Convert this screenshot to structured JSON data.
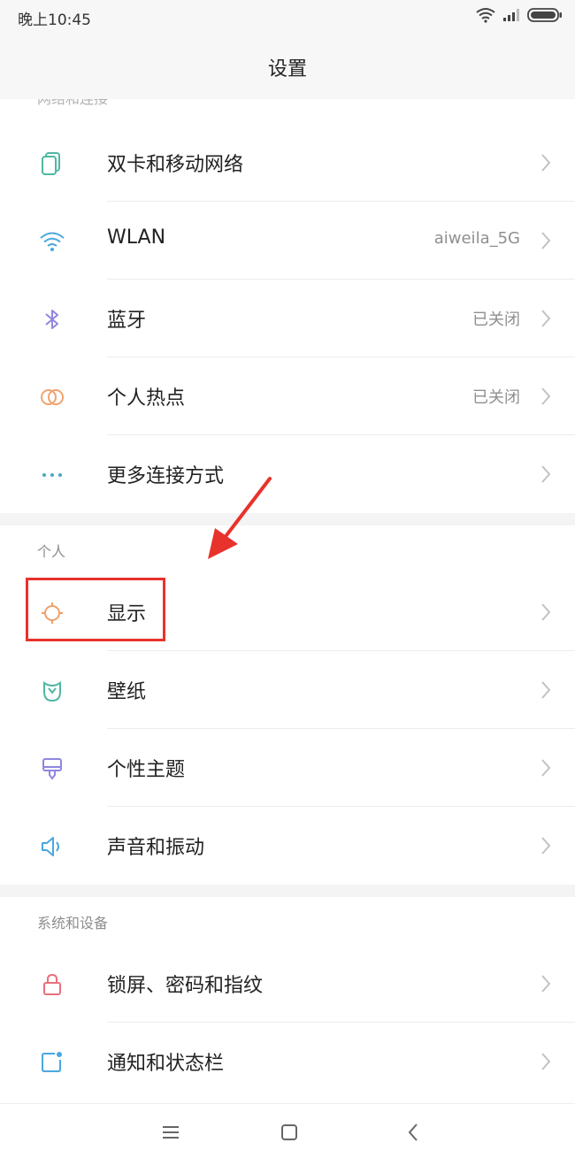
{
  "status_bar": {
    "time": "晚上10:45",
    "icons": [
      "wifi-icon",
      "signal-icon",
      "battery-icon"
    ]
  },
  "header": {
    "title": "设置"
  },
  "sections": {
    "network": {
      "header_partial": "网络和连接",
      "items": [
        {
          "label": "双卡和移动网络",
          "value": "",
          "icon": "sim-cards-icon",
          "icon_color": "#4fb7a3"
        },
        {
          "label": "WLAN",
          "value": "aiweila_5G",
          "icon": "wifi-icon",
          "icon_color": "#4aa7e0"
        },
        {
          "label": "蓝牙",
          "value": "已关闭",
          "icon": "bluetooth-icon",
          "icon_color": "#8f86e0"
        },
        {
          "label": "个人热点",
          "value": "已关闭",
          "icon": "hotspot-icon",
          "icon_color": "#f0a370"
        },
        {
          "label": "更多连接方式",
          "value": "",
          "icon": "more-dots-icon",
          "icon_color": "#4aa7c7"
        }
      ]
    },
    "personal": {
      "header": "个人",
      "items": [
        {
          "label": "显示",
          "value": "",
          "icon": "brightness-icon",
          "icon_color": "#f0a06a"
        },
        {
          "label": "壁纸",
          "value": "",
          "icon": "wallpaper-icon",
          "icon_color": "#4fb7a3"
        },
        {
          "label": "个性主题",
          "value": "",
          "icon": "theme-brush-icon",
          "icon_color": "#8f86e0"
        },
        {
          "label": "声音和振动",
          "value": "",
          "icon": "speaker-icon",
          "icon_color": "#4aa7e0"
        }
      ]
    },
    "system": {
      "header": "系统和设备",
      "items": [
        {
          "label": "锁屏、密码和指纹",
          "value": "",
          "icon": "lock-icon",
          "icon_color": "#e8707a"
        },
        {
          "label": "通知和状态栏",
          "value": "",
          "icon": "notification-icon",
          "icon_color": "#4aa7e0"
        }
      ]
    }
  },
  "annotation": {
    "highlight_color": "#e8322c",
    "highlighted_item": "显示"
  },
  "nav_bar": {
    "buttons": [
      "menu-icon",
      "home-icon",
      "back-icon"
    ]
  }
}
